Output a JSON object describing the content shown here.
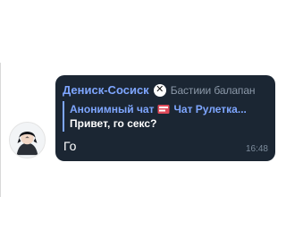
{
  "message": {
    "sender_name": "Дениск-Сосиск",
    "sender_title": "Бастиии балапан",
    "reply": {
      "source_left": "Анонимный чат",
      "source_right": "Чат Рулетка...",
      "text": "Привет, го секс?"
    },
    "text": "Го",
    "time": "16:48"
  },
  "colors": {
    "bubble": "#1b2633",
    "accent": "#7ea6ff",
    "muted": "#8b98a8"
  }
}
